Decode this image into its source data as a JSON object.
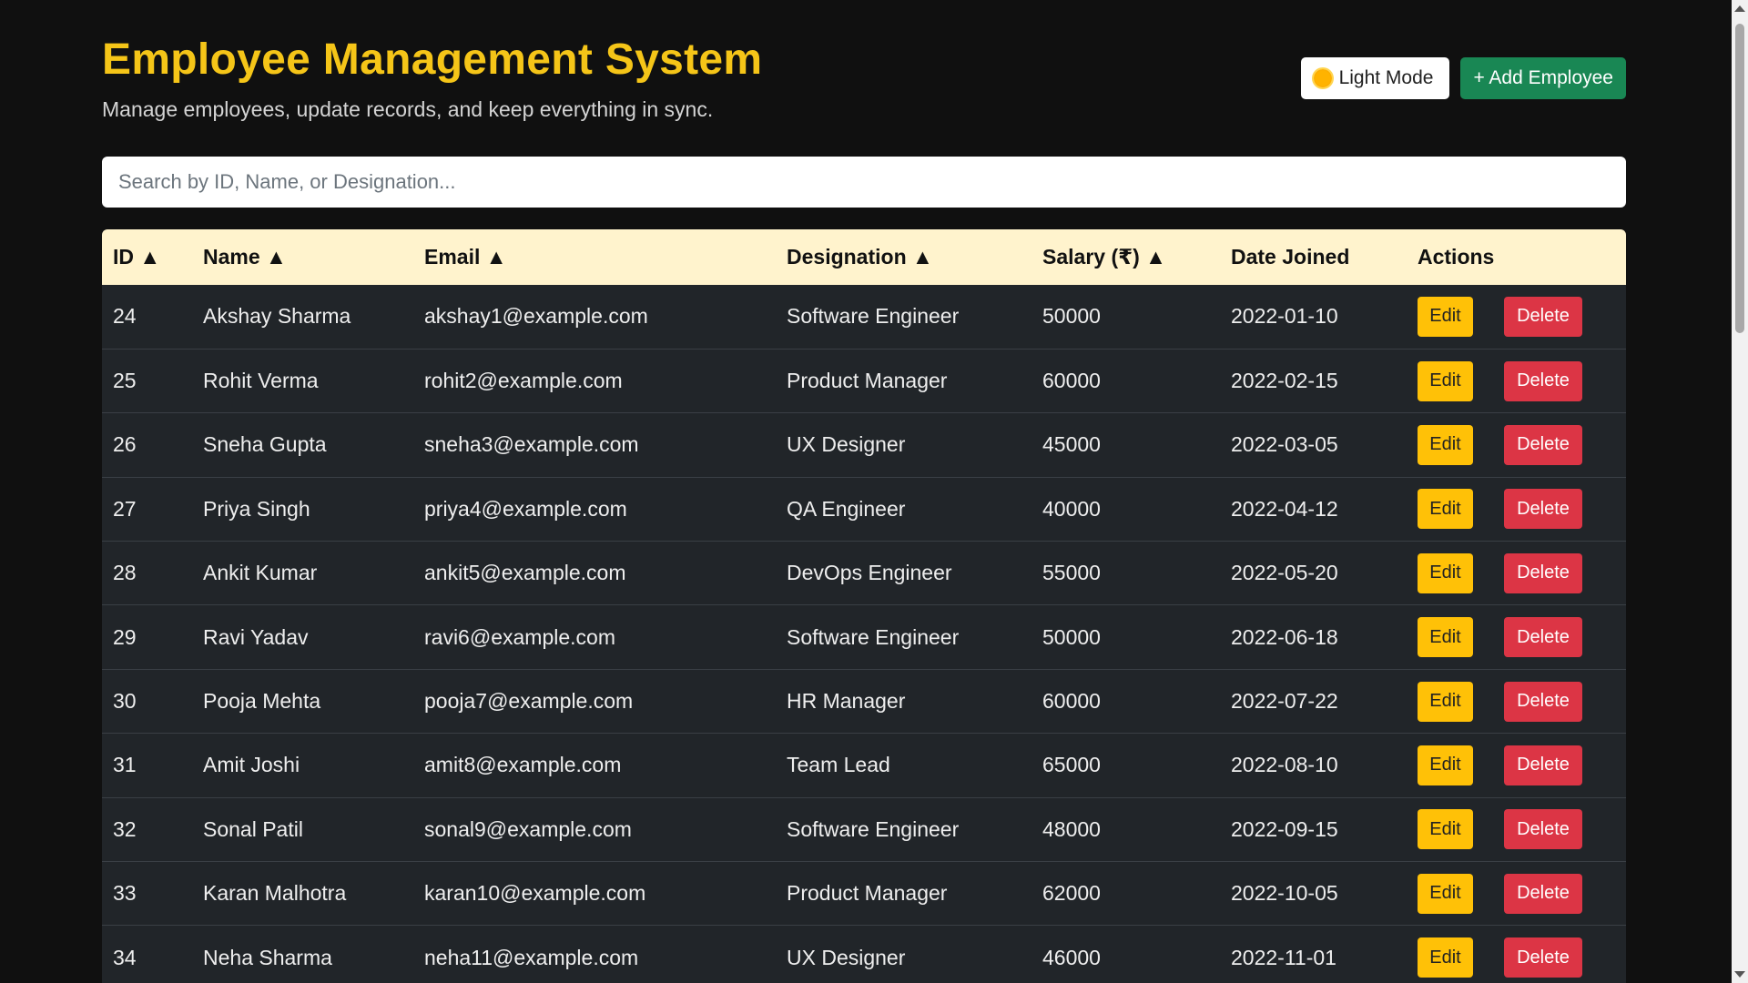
{
  "header": {
    "title": "Employee Management System",
    "subtitle": "Manage employees, update records, and keep everything in sync.",
    "theme_button_label": "Light Mode",
    "theme_icon": "sun-icon",
    "add_button_label": "+ Add Employee"
  },
  "search": {
    "placeholder": "Search by ID, Name, or Designation...",
    "value": ""
  },
  "table": {
    "columns": [
      "ID ▲",
      "Name ▲",
      "Email ▲",
      "Designation ▲",
      "Salary (₹) ▲",
      "Date Joined",
      "Actions"
    ],
    "edit_label": "Edit",
    "delete_label": "Delete",
    "rows": [
      {
        "id": "24",
        "name": "Akshay Sharma",
        "email": "akshay1@example.com",
        "designation": "Software Engineer",
        "salary": "50000",
        "date": "2022-01-10"
      },
      {
        "id": "25",
        "name": "Rohit Verma",
        "email": "rohit2@example.com",
        "designation": "Product Manager",
        "salary": "60000",
        "date": "2022-02-15"
      },
      {
        "id": "26",
        "name": "Sneha Gupta",
        "email": "sneha3@example.com",
        "designation": "UX Designer",
        "salary": "45000",
        "date": "2022-03-05"
      },
      {
        "id": "27",
        "name": "Priya Singh",
        "email": "priya4@example.com",
        "designation": "QA Engineer",
        "salary": "40000",
        "date": "2022-04-12"
      },
      {
        "id": "28",
        "name": "Ankit Kumar",
        "email": "ankit5@example.com",
        "designation": "DevOps Engineer",
        "salary": "55000",
        "date": "2022-05-20"
      },
      {
        "id": "29",
        "name": "Ravi Yadav",
        "email": "ravi6@example.com",
        "designation": "Software Engineer",
        "salary": "50000",
        "date": "2022-06-18"
      },
      {
        "id": "30",
        "name": "Pooja Mehta",
        "email": "pooja7@example.com",
        "designation": "HR Manager",
        "salary": "60000",
        "date": "2022-07-22"
      },
      {
        "id": "31",
        "name": "Amit Joshi",
        "email": "amit8@example.com",
        "designation": "Team Lead",
        "salary": "65000",
        "date": "2022-08-10"
      },
      {
        "id": "32",
        "name": "Sonal Patil",
        "email": "sonal9@example.com",
        "designation": "Software Engineer",
        "salary": "48000",
        "date": "2022-09-15"
      },
      {
        "id": "33",
        "name": "Karan Malhotra",
        "email": "karan10@example.com",
        "designation": "Product Manager",
        "salary": "62000",
        "date": "2022-10-05"
      },
      {
        "id": "34",
        "name": "Neha Sharma",
        "email": "neha11@example.com",
        "designation": "UX Designer",
        "salary": "46000",
        "date": "2022-11-01"
      }
    ]
  },
  "colors": {
    "background": "#101010",
    "title": "#f5c518",
    "header_row": "#fff3cd",
    "row": "#212529",
    "edit": "#ffc107",
    "delete": "#dc3545",
    "add": "#198754"
  }
}
